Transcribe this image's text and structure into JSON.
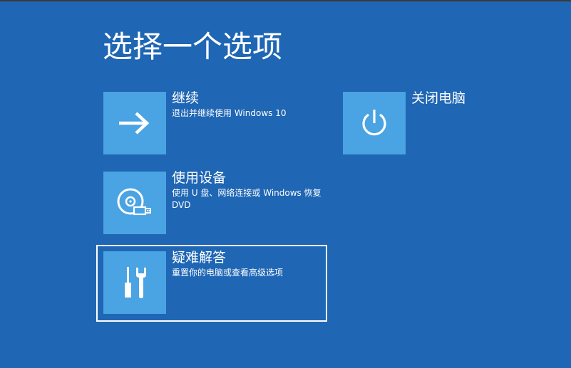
{
  "title": "选择一个选项",
  "options": [
    {
      "id": "continue",
      "title": "继续",
      "description": "退出并继续使用 Windows 10",
      "icon": "arrow-right-icon"
    },
    {
      "id": "use-device",
      "title": "使用设备",
      "description": "使用 U 盘、网络连接或 Windows 恢复 DVD",
      "icon": "disc-usb-icon"
    },
    {
      "id": "troubleshoot",
      "title": "疑难解答",
      "description": "重置你的电脑或查看高级选项",
      "icon": "tools-icon",
      "focused": true
    },
    {
      "id": "shutdown",
      "title": "关闭电脑",
      "description": "",
      "icon": "power-icon"
    }
  ],
  "colors": {
    "background": "#1f66b4",
    "tile": "#4aa3e2",
    "text": "#ffffff",
    "focus_border": "#ffffff"
  }
}
